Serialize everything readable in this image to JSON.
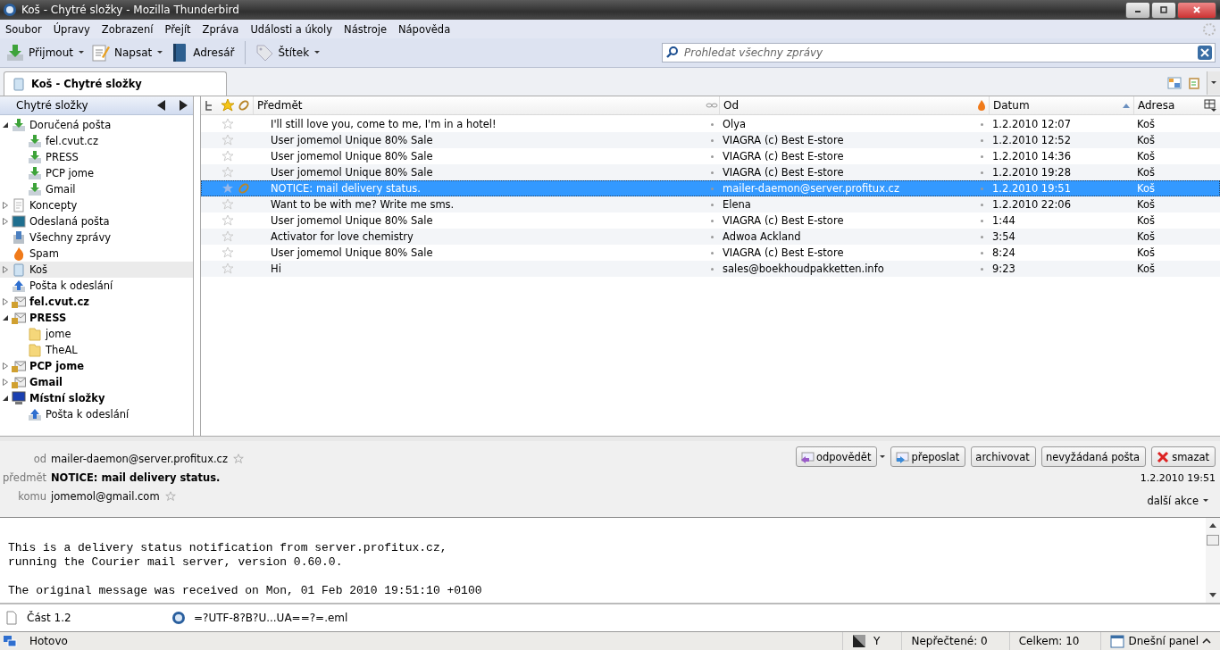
{
  "window": {
    "title": "Koš - Chytré složky - Mozilla Thunderbird"
  },
  "menu": [
    "Soubor",
    "Úpravy",
    "Zobrazení",
    "Přejít",
    "Zpráva",
    "Události a úkoly",
    "Nástroje",
    "Nápověda"
  ],
  "toolbar": [
    {
      "label": "Přijmout",
      "kind": "get",
      "dropdown": true
    },
    {
      "label": "Napsat",
      "kind": "write",
      "dropdown": true
    },
    {
      "label": "Adresář",
      "kind": "book",
      "dropdown": false
    },
    {
      "label": "Štítek",
      "kind": "tag",
      "dropdown": true
    }
  ],
  "search": {
    "placeholder": "Prohledat všechny zprávy"
  },
  "tabs": [
    {
      "label": "Koš - Chytré složky",
      "selected": true
    }
  ],
  "folder_pane": {
    "title": "Chytré složky",
    "folders": [
      {
        "label": "Doručená pošta",
        "kind": "inbox",
        "bold": false,
        "selected": false,
        "expandable": true,
        "expanded": true,
        "children": [
          {
            "label": "fel.cvut.cz",
            "kind": "inbox",
            "bold": false,
            "selected": false,
            "expandable": false
          },
          {
            "label": "PRESS",
            "kind": "inbox",
            "bold": false,
            "selected": false,
            "expandable": false
          },
          {
            "label": "PCP jome",
            "kind": "inbox",
            "bold": false,
            "selected": false,
            "expandable": false
          },
          {
            "label": "Gmail",
            "kind": "inbox",
            "bold": false,
            "selected": false,
            "expandable": false
          }
        ]
      },
      {
        "label": "Koncepty",
        "kind": "draft",
        "bold": false,
        "selected": false,
        "expandable": true,
        "expanded": false
      },
      {
        "label": "Odeslaná pošta",
        "kind": "sent",
        "bold": false,
        "selected": false,
        "expandable": true,
        "expanded": false
      },
      {
        "label": "Všechny zprávy",
        "kind": "archive",
        "bold": false,
        "selected": false,
        "expandable": false
      },
      {
        "label": "Spam",
        "kind": "spam",
        "bold": false,
        "selected": false,
        "expandable": false
      },
      {
        "label": "Koš",
        "kind": "trash",
        "bold": false,
        "selected": true,
        "expandable": true,
        "expanded": false
      },
      {
        "label": "Pošta k odeslání",
        "kind": "outbox",
        "bold": false,
        "selected": false,
        "expandable": false
      },
      {
        "label": "fel.cvut.cz",
        "kind": "account",
        "bold": true,
        "selected": false,
        "expandable": true,
        "expanded": false
      },
      {
        "label": "PRESS",
        "kind": "account",
        "bold": true,
        "selected": false,
        "expandable": true,
        "expanded": true,
        "children": [
          {
            "label": "jome",
            "kind": "folder",
            "bold": false,
            "selected": false,
            "expandable": false
          },
          {
            "label": "TheAL",
            "kind": "folder",
            "bold": false,
            "selected": false,
            "expandable": false
          }
        ]
      },
      {
        "label": "PCP jome",
        "kind": "account",
        "bold": true,
        "selected": false,
        "expandable": true,
        "expanded": false
      },
      {
        "label": "Gmail",
        "kind": "account",
        "bold": true,
        "selected": false,
        "expandable": true,
        "expanded": false
      },
      {
        "label": "Místní složky",
        "kind": "local",
        "bold": true,
        "selected": false,
        "expandable": true,
        "expanded": true,
        "children": [
          {
            "label": "Pošta k odeslání",
            "kind": "outbox",
            "bold": false,
            "selected": false,
            "expandable": false
          }
        ]
      }
    ]
  },
  "message_list": {
    "columns": [
      "Předmět",
      "Od",
      "Datum",
      "Adresa"
    ],
    "rows": [
      {
        "subject": "I'll still love you, come to me, I'm in a hotel!",
        "from": "Olya",
        "date": "1.2.2010 12:07",
        "folder": "Koš",
        "selected": false,
        "attachment": false
      },
      {
        "subject": "User jomemol Unique 80% Sale",
        "from": "VIAGRA (c) Best E-store",
        "date": "1.2.2010 12:52",
        "folder": "Koš",
        "selected": false,
        "attachment": false
      },
      {
        "subject": "User jomemol Unique 80% Sale",
        "from": "VIAGRA (c) Best E-store",
        "date": "1.2.2010 14:36",
        "folder": "Koš",
        "selected": false,
        "attachment": false
      },
      {
        "subject": "User jomemol Unique 80% Sale",
        "from": "VIAGRA (c) Best E-store",
        "date": "1.2.2010 19:28",
        "folder": "Koš",
        "selected": false,
        "attachment": false
      },
      {
        "subject": "NOTICE: mail delivery status.",
        "from": "mailer-daemon@server.profitux.cz",
        "date": "1.2.2010 19:51",
        "folder": "Koš",
        "selected": true,
        "attachment": true
      },
      {
        "subject": "Want to be with me? Write me sms.",
        "from": "Elena",
        "date": "1.2.2010 22:06",
        "folder": "Koš",
        "selected": false,
        "attachment": false
      },
      {
        "subject": "User jomemol Unique 80% Sale",
        "from": "VIAGRA (c) Best E-store",
        "date": "1:44",
        "folder": "Koš",
        "selected": false,
        "attachment": false
      },
      {
        "subject": "Activator for love chemistry",
        "from": "Adwoa Ackland",
        "date": "3:54",
        "folder": "Koš",
        "selected": false,
        "attachment": false
      },
      {
        "subject": "User jomemol Unique 80% Sale",
        "from": "VIAGRA (c) Best E-store",
        "date": "8:24",
        "folder": "Koš",
        "selected": false,
        "attachment": false
      },
      {
        "subject": "Hi",
        "from": "sales@boekhoudpakketten.info",
        "date": "9:23",
        "folder": "Koš",
        "selected": false,
        "attachment": false
      }
    ]
  },
  "message_header": {
    "fields": [
      {
        "label": "od",
        "value": "mailer-daemon@server.profitux.cz",
        "kind": "address"
      },
      {
        "label": "předmět",
        "value": "NOTICE: mail delivery status.",
        "kind": "subject"
      },
      {
        "label": "komu",
        "value": "jomemol@gmail.com",
        "kind": "address"
      }
    ],
    "buttons": [
      {
        "label": "odpovědět",
        "kind": "reply",
        "dropdown": true
      },
      {
        "label": "přeposlat",
        "kind": "forward",
        "dropdown": false
      },
      {
        "label": "archivovat",
        "kind": "plain",
        "dropdown": false
      },
      {
        "label": "nevyžádaná pošta",
        "kind": "plain",
        "dropdown": false
      },
      {
        "label": "smazat",
        "kind": "delete",
        "dropdown": false
      }
    ],
    "date": "1.2.2010 19:51",
    "more_actions": "další akce"
  },
  "message_body": [
    [
      "This is a delivery status notification from server.profitux.cz,",
      "running the Courier mail server, version 0.60.0."
    ],
    [
      "The original message was received on Mon, 01 Feb 2010 19:51:10 +0100"
    ]
  ],
  "attachments": [
    {
      "name": "Část 1.2",
      "kind": "file"
    },
    {
      "name": "=?UTF-8?B?U...UA==?=.eml",
      "kind": "message"
    }
  ],
  "status_bar": {
    "status": "Hotovo",
    "offline": "Y",
    "unread": "Nepřečtené: 0",
    "total": "Celkem: 10",
    "today_pane": "Dnešní panel"
  }
}
